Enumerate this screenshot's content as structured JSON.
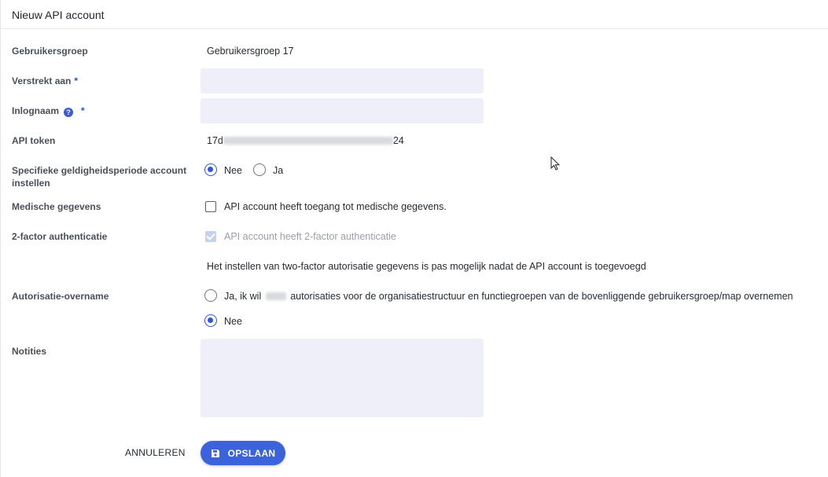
{
  "header": {
    "title": "Nieuw API account"
  },
  "form": {
    "usergroup": {
      "label": "Gebruikersgroep",
      "value": "Gebruikersgroep 17"
    },
    "issued_to": {
      "label": "Verstrekt aan",
      "required_mark": "*",
      "value": "",
      "placeholder": ""
    },
    "login": {
      "label": "Inlognaam",
      "help_icon": "?",
      "required_mark": "*",
      "value": "",
      "placeholder": ""
    },
    "api_token": {
      "label": "API token",
      "value_prefix": "17d",
      "value_suffix": "24"
    },
    "validity": {
      "label": "Specifieke geldigheidsperiode account instellen",
      "options": [
        "Nee",
        "Ja"
      ],
      "selected": "Nee"
    },
    "medical": {
      "label": "Medische gegevens",
      "checkbox_label": "API account heeft toegang tot medische gegevens.",
      "checked": false
    },
    "twofactor": {
      "label": "2-factor authenticatie",
      "checkbox_label": "API account heeft 2-factor authenticatie",
      "checked": true,
      "disabled": true,
      "note": "Het instellen van two-factor autorisatie gegevens is pas mogelijk nadat de API account is toegevoegd"
    },
    "auth_takeover": {
      "label": "Autorisatie-overname",
      "option_yes_prefix": "Ja, ik wil",
      "option_yes_suffix": "autorisaties voor de organisatiestructuur en functiegroepen van de bovenliggende gebruikersgroep/map overnemen",
      "option_no": "Nee",
      "selected": "Nee"
    },
    "notes": {
      "label": "Notities",
      "value": ""
    }
  },
  "actions": {
    "cancel_label": "ANNULEREN",
    "save_label": "OPSLAAN",
    "save_icon": "floppy-disk-icon"
  },
  "colors": {
    "accent": "#3b63dc",
    "input_bg": "#efeff9"
  }
}
